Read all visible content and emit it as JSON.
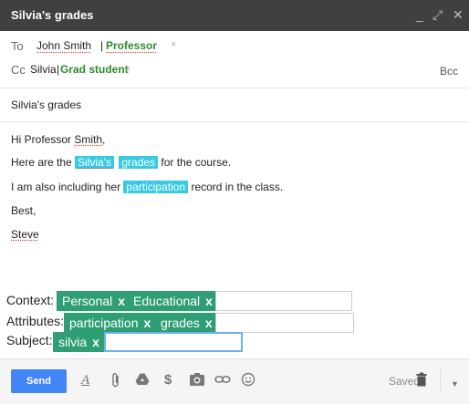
{
  "window": {
    "title": "Silvia's grades",
    "minimize": "_",
    "expand": "⤢",
    "close": "✕"
  },
  "recipients": {
    "to_label": "To",
    "to_name": "John Smith",
    "to_separator": "|",
    "to_role": "Professor",
    "to_remove": "×",
    "cc_label": "Cc",
    "cc_name": "Silvia",
    "cc_separator": "|",
    "cc_role": "Grad student",
    "cc_remove": "×",
    "bcc_label": "Bcc"
  },
  "subject": "Silvia's grades",
  "body": {
    "greeting_prefix": "Hi Professor ",
    "greeting_name": "Smith",
    "greeting_suffix": ",",
    "line2_prefix": "Here are the ",
    "line2_hl1": "Silvia's",
    "line2_hl2": "grades",
    "line2_suffix": " for the course.",
    "line3_prefix": "I am also including her ",
    "line3_hl": "participation",
    "line3_suffix": " record  in the class.",
    "closing": "Best,",
    "signature": "Steve"
  },
  "annotations": {
    "context_label": "Context:",
    "context_tags": [
      "Personal",
      "Educational"
    ],
    "attributes_label": "Attributes:",
    "attributes_tags": [
      "participation",
      "grades"
    ],
    "subject_label": "Subject:",
    "subject_tags": [
      "silvia"
    ],
    "tag_remove": "x"
  },
  "toolbar": {
    "send_label": "Send",
    "saved_label": "Saved",
    "icons": [
      "format-text-icon",
      "attach-icon",
      "drive-icon",
      "money-icon",
      "photo-icon",
      "link-icon",
      "emoji-icon",
      "trash-icon",
      "more-options-icon"
    ]
  },
  "colors": {
    "titlebar": "#404040",
    "highlight": "#38c9e3",
    "tag": "#2f9e74",
    "role": "#2e8b2e",
    "send": "#4285f4"
  }
}
